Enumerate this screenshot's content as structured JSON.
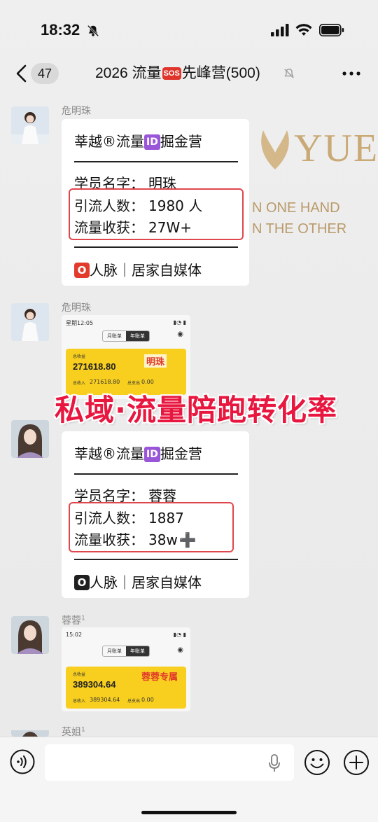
{
  "status_bar": {
    "time": "18:32"
  },
  "nav": {
    "unread_count": "47",
    "title_prefix": "2026 流量",
    "sos": "SOS",
    "title_suffix": "先峰营(500)"
  },
  "background": {
    "logo": "YUE",
    "line1": "N ONE HAND",
    "line2": "N THE OTHER"
  },
  "overlay_banner": "私域·流量陪跑转化率",
  "messages": [
    {
      "sender": "危明珠",
      "card": {
        "header_pre": "莘越®流量",
        "id_badge": "ID",
        "header_post": "掘金营",
        "divider": "————————",
        "student_label": "学员名字：",
        "student_name": "明珠",
        "traffic_label": "引流人数：",
        "traffic_value": "1980 人",
        "income_label": "流量收获：",
        "income_value": "27W+",
        "footer_badge": "O",
        "footer_text": "人脉｜居家自媒体"
      }
    },
    {
      "sender": "危明珠",
      "screenshot": {
        "time": "星期12:05",
        "tab1": "月账单",
        "tab2": "年账单",
        "total_label": "总收益",
        "total": "271618.80",
        "name_tag": "明珠",
        "income_label": "总收入",
        "income": "271618.80",
        "expense_label": "总支出",
        "expense": "0.00"
      }
    },
    {
      "sender": "",
      "card": {
        "header_pre": "莘越®流量",
        "id_badge": "ID",
        "header_post": "掘金营",
        "divider": "————————",
        "student_label": "学员名字：",
        "student_name": "蓉蓉",
        "traffic_label": "引流人数：",
        "traffic_value": "1887",
        "income_label": "流量收获：",
        "income_value": "38w",
        "plus": "➕",
        "footer_badge": "O",
        "footer_text": "人脉｜居家自媒体"
      }
    },
    {
      "sender": "蓉蓉",
      "sender_sup": "1",
      "screenshot": {
        "time": "15:02",
        "tab1": "月账单",
        "tab2": "年账单",
        "total_label": "总收益",
        "total": "389304.64",
        "name_tag": "蓉蓉专属",
        "income_label": "总收入",
        "income": "389304.64",
        "expense_label": "总支出",
        "expense": "0.00"
      }
    },
    {
      "sender": "英姐",
      "sender_sup": "1"
    }
  ],
  "input": {
    "placeholder": ""
  },
  "colors": {
    "accent_red": "#e0474c",
    "banner_red": "#e8173f",
    "id_purple": "#9a56d8",
    "yellow": "#f8cf1f"
  }
}
